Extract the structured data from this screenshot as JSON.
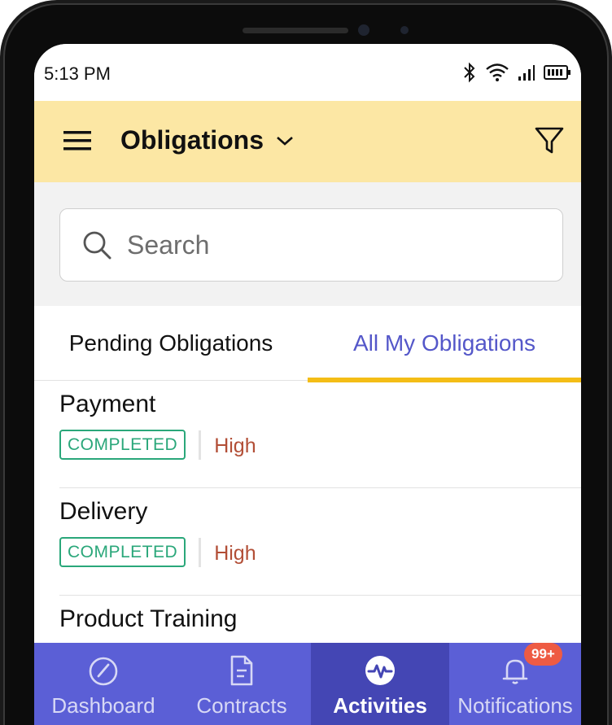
{
  "status_bar": {
    "time": "5:13 PM",
    "icons": [
      "bluetooth-icon",
      "wifi-icon",
      "signal-icon",
      "battery-icon"
    ]
  },
  "header": {
    "title": "Obligations",
    "menu_icon": "hamburger-menu-icon",
    "dropdown_icon": "chevron-down-icon",
    "filter_icon": "filter-icon",
    "background": "#fce7a4"
  },
  "search": {
    "placeholder": "Search",
    "value": "",
    "icon": "search-icon"
  },
  "tabs": [
    {
      "label": "Pending Obligations",
      "active": false
    },
    {
      "label": "All My Obligations",
      "active": true
    }
  ],
  "obligations": [
    {
      "title": "Payment",
      "status": "COMPLETED",
      "priority": "High"
    },
    {
      "title": "Delivery",
      "status": "COMPLETED",
      "priority": "High"
    },
    {
      "title": "Product Training",
      "status": "",
      "priority": ""
    }
  ],
  "bottom_nav": {
    "items": [
      {
        "label": "Dashboard",
        "icon": "speedometer-icon",
        "active": false
      },
      {
        "label": "Contracts",
        "icon": "document-icon",
        "active": false
      },
      {
        "label": "Activities",
        "icon": "pulse-icon",
        "active": true
      },
      {
        "label": "Notifications",
        "icon": "bell-icon",
        "active": false,
        "badge": "99+"
      }
    ]
  },
  "colors": {
    "accent": "#5b5fd6",
    "accent_dark": "#4446b4",
    "tab_indicator": "#f4bd16",
    "completed": "#2aa77a",
    "priority_high": "#b24e36",
    "badge": "#ee5b43"
  }
}
